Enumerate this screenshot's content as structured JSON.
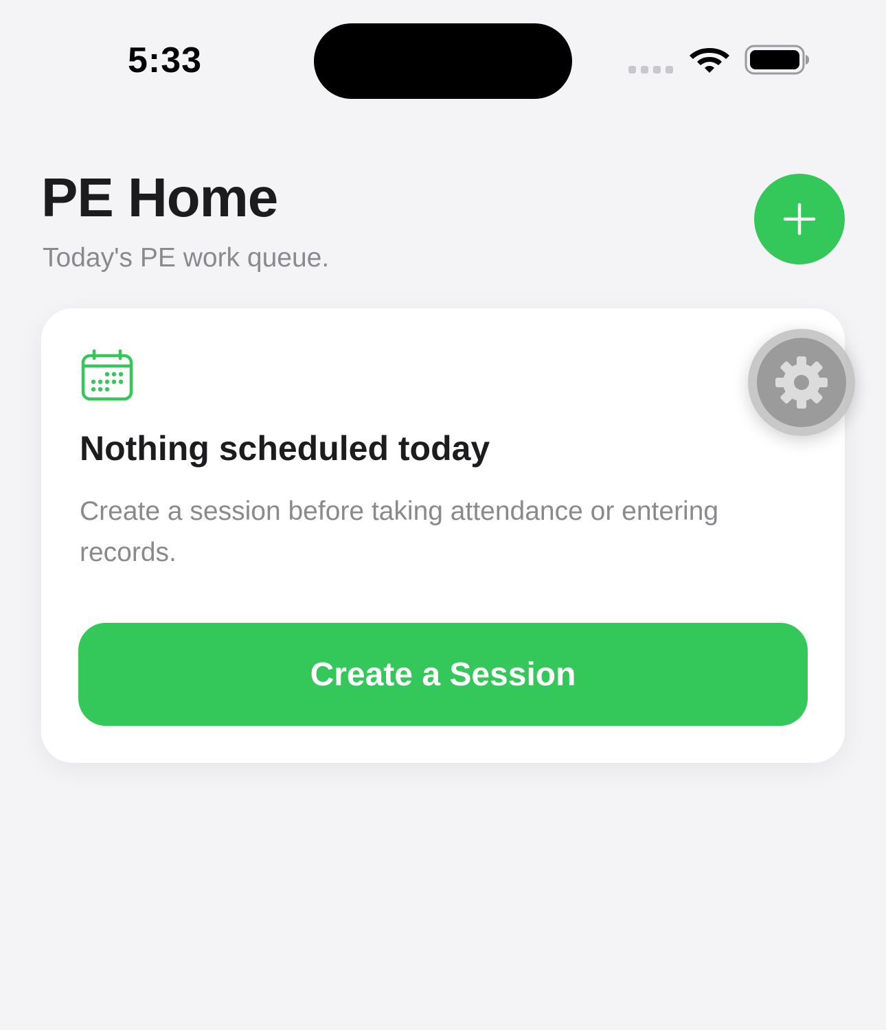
{
  "status_bar": {
    "time": "5:33"
  },
  "header": {
    "title": "PE Home",
    "subtitle": "Today's PE work queue.",
    "add_icon": "plus-icon"
  },
  "card": {
    "icon": "calendar-icon",
    "title": "Nothing scheduled today",
    "body": "Create a session before taking attendance or entering records.",
    "button_label": "Create a Session"
  },
  "floating": {
    "icon": "gear-icon"
  },
  "colors": {
    "accent": "#34c759",
    "background": "#f4f4f6",
    "card": "#ffffff",
    "text_primary": "#1c1c1e",
    "text_secondary": "#8a8a8e"
  }
}
